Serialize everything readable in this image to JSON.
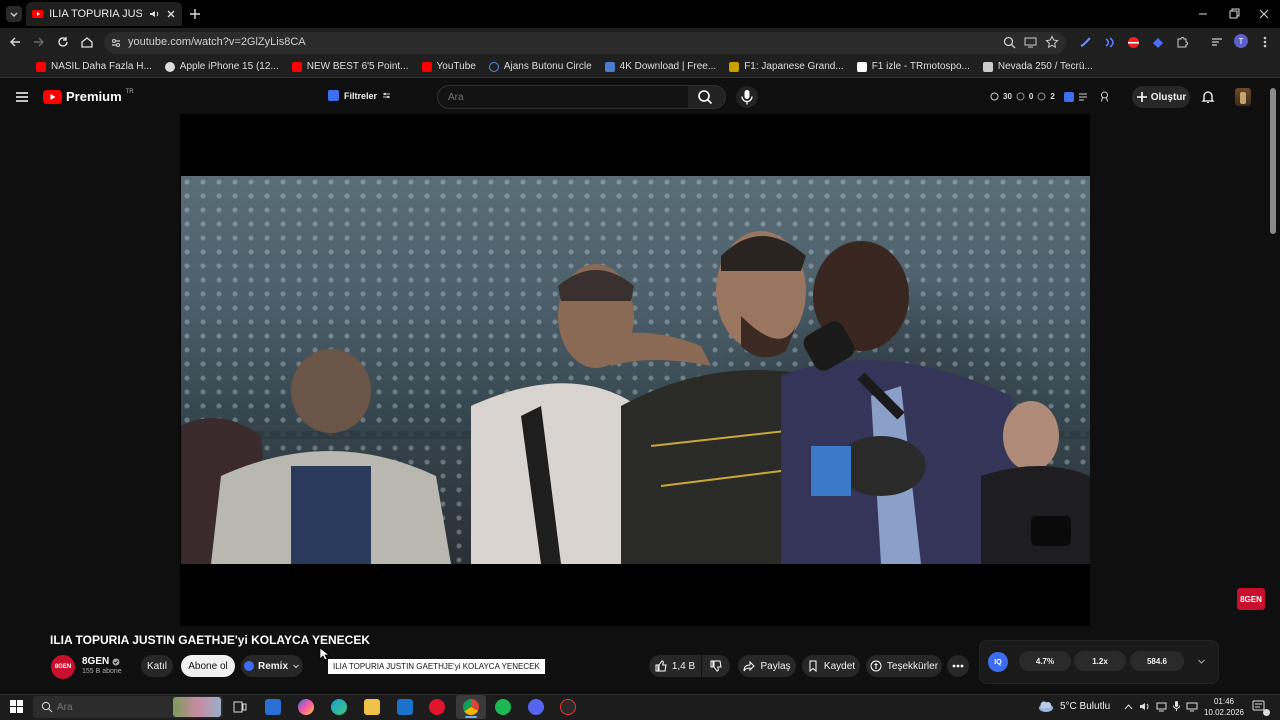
{
  "browser": {
    "tab_title": "ILIA TOPURIA JUSTIN GAETH",
    "url": "youtube.com/watch?v=2GlZyLis8CA",
    "bookmarks": [
      {
        "label": "NASIL Daha Fazla H...",
        "color": "#ff0000"
      },
      {
        "label": "Apple iPhone 15 (12...",
        "color": "#ffffff"
      },
      {
        "label": "NEW BEST 6'5 Point...",
        "color": "#ff0000"
      },
      {
        "label": "YouTube",
        "color": "#ff0000"
      },
      {
        "label": "Ajans Butonu Circle",
        "color": "#4a90e2"
      },
      {
        "label": "4K Download | Free...",
        "color": "#4a7bd0"
      },
      {
        "label": "F1: Japanese Grand...",
        "color": "#c8a000"
      },
      {
        "label": "F1 izle - TRmotospo...",
        "color": "#ffffff"
      },
      {
        "label": "Nevada 250 / Tecrü...",
        "color": "#dddddd"
      }
    ]
  },
  "header": {
    "logo": "Premium",
    "logo_superscript": "TR",
    "filters_label": "Filtreler",
    "search_placeholder": "Ara",
    "stats": {
      "views": "30",
      "zero": "0",
      "two": "2"
    },
    "create_label": "Oluştur"
  },
  "video": {
    "title": "ILIA TOPURIA JUSTIN GAETHJE'yi KOLAYCA YENECEK",
    "watermark": "8GEN"
  },
  "channel": {
    "name": "8GEN",
    "subscribers": "155 B abone",
    "avatar_text": "8GEN",
    "join_label": "Katıl",
    "subscribe_label": "Abone ol",
    "remix_label": "Remix"
  },
  "tooltip": "ILIA TOPURIA JUSTIN GAETHJE'yi KOLAYCA YENECEK",
  "actions": {
    "likes": "1,4 B",
    "share": "Paylaş",
    "save": "Kaydet",
    "thanks": "Teşekkürler"
  },
  "iq_panel": {
    "badge": "IQ",
    "values": [
      "4.7%",
      "1.2x",
      "584.6"
    ]
  },
  "taskbar": {
    "search_placeholder": "Ara",
    "weather": "5°C  Bulutlu",
    "time": "01:46",
    "date": "10.02.2026"
  },
  "colors": {
    "accent_red": "#ff0000",
    "iq_blue": "#3d6df2"
  }
}
